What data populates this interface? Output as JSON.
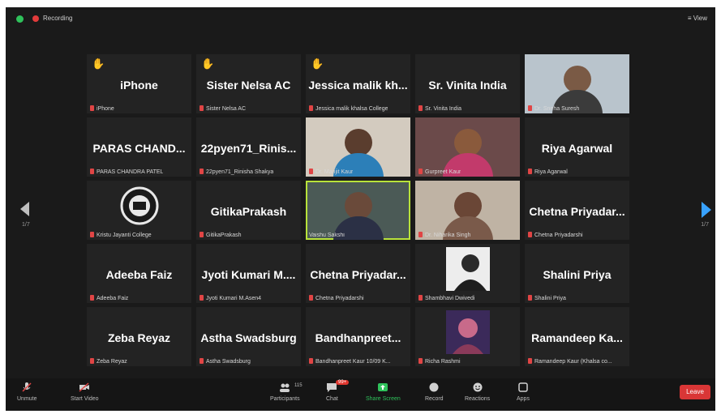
{
  "topbar": {
    "recording_label": "Recording",
    "view_label": "View"
  },
  "navigation": {
    "left_page": "1/7",
    "right_page": "1/7"
  },
  "tiles": [
    {
      "display": "iPhone",
      "label": "iPhone",
      "hand": true
    },
    {
      "display": "Sister Nelsa AC",
      "label": "Sister Nelsa AC",
      "hand": true
    },
    {
      "display": "Jessica malik kh...",
      "label": "Jessica malik khalsa College",
      "hand": true
    },
    {
      "display": "Sr. Vinita India",
      "label": "Sr. Vinita India",
      "hand": false
    },
    {
      "display": "",
      "label": "Dr. Sneha Suresh",
      "hand": false
    },
    {
      "display": "PARAS CHAND...",
      "label": "PARAS CHANDRA PATEL",
      "hand": false
    },
    {
      "display": "22pyen71_Rinis...",
      "label": "22pyen71_Rinisha Shakya",
      "hand": false
    },
    {
      "display": "",
      "label": "Dr. Manjit Kaur",
      "hand": false
    },
    {
      "display": "",
      "label": "Gurpreet Kaur",
      "hand": false
    },
    {
      "display": "Riya Agarwal",
      "label": "Riya Agarwal",
      "hand": false
    },
    {
      "display": "",
      "label": "Kristu Jayanti College",
      "hand": false
    },
    {
      "display": "GitikaPrakash",
      "label": "GitikaPrakash",
      "hand": false
    },
    {
      "display": "",
      "label": "Vaishu Sakshi",
      "hand": false
    },
    {
      "display": "",
      "label": "Dr. Niharika Singh",
      "hand": false
    },
    {
      "display": "Chetna  Priyadar...",
      "label": "Chetna Priyadarshi",
      "hand": false
    },
    {
      "display": "Adeeba Faiz",
      "label": "Adeeba Faiz",
      "hand": false
    },
    {
      "display": "Jyoti Kumari M....",
      "label": "Jyoti Kumari M.Asen4",
      "hand": false
    },
    {
      "display": "Chetna  Priyadar...",
      "label": "Chetna Priyadarshi",
      "hand": false
    },
    {
      "display": "",
      "label": "Shambhavi Dwivedi",
      "hand": false
    },
    {
      "display": "Shalini Priya",
      "label": "Shalini Priya",
      "hand": false
    },
    {
      "display": "Zeba Reyaz",
      "label": "Zeba Reyaz",
      "hand": false
    },
    {
      "display": "Astha Swadsburg",
      "label": "Astha Swadsburg",
      "hand": false
    },
    {
      "display": "Bandhanpreet...",
      "label": "Bandhanpreet Kaur 10/09 K...",
      "hand": false
    },
    {
      "display": "",
      "label": "Richa Rashmi",
      "hand": false
    },
    {
      "display": "Ramandeep  Ka...",
      "label": "Ramandeep Kaur (Khalsa co...",
      "hand": false
    }
  ],
  "toolbar": {
    "unmute": "Unmute",
    "start_video": "Start Video",
    "participants": "Participants",
    "participants_count": "115",
    "chat": "Chat",
    "chat_badge": "99+",
    "share_screen": "Share Screen",
    "record": "Record",
    "reactions": "Reactions",
    "apps": "Apps",
    "leave": "Leave"
  },
  "colors": {
    "accent_green": "#2fc25b",
    "leave_red": "#d93636",
    "next_arrow": "#38a2ff"
  }
}
